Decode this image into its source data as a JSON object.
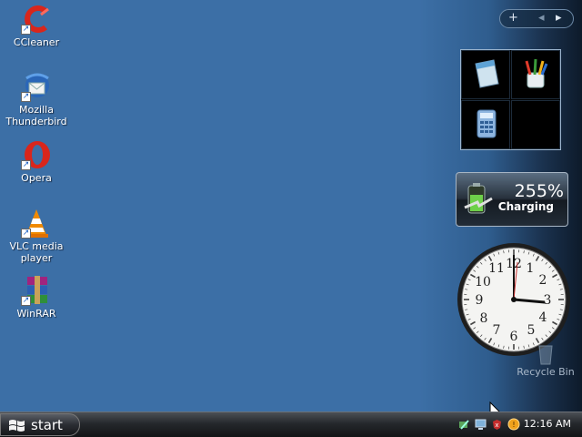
{
  "desktop": {
    "icons": [
      {
        "label": "CCleaner",
        "icon": "ccleaner-icon"
      },
      {
        "label": "Mozilla Thunderbird",
        "icon": "thunderbird-icon"
      },
      {
        "label": "Opera",
        "icon": "opera-icon"
      },
      {
        "label": "VLC media player",
        "icon": "vlc-icon"
      },
      {
        "label": "WinRAR",
        "icon": "winrar-icon"
      }
    ],
    "recycle_bin": "Recycle Bin"
  },
  "sidebar": {
    "add_symbol": "+",
    "prev_symbol": "◂",
    "next_symbol": "▸"
  },
  "battery_gadget": {
    "percent": "255%",
    "status": "Charging"
  },
  "clock_gadget": {
    "numbers": [
      "12",
      "1",
      "2",
      "3",
      "4",
      "5",
      "6",
      "7",
      "8",
      "9",
      "10",
      "11"
    ]
  },
  "taskbar": {
    "start_label": "start",
    "time": "12:16 AM"
  },
  "colors": {
    "desktop": "#3c6fa6",
    "taskbar": "#25282c"
  }
}
